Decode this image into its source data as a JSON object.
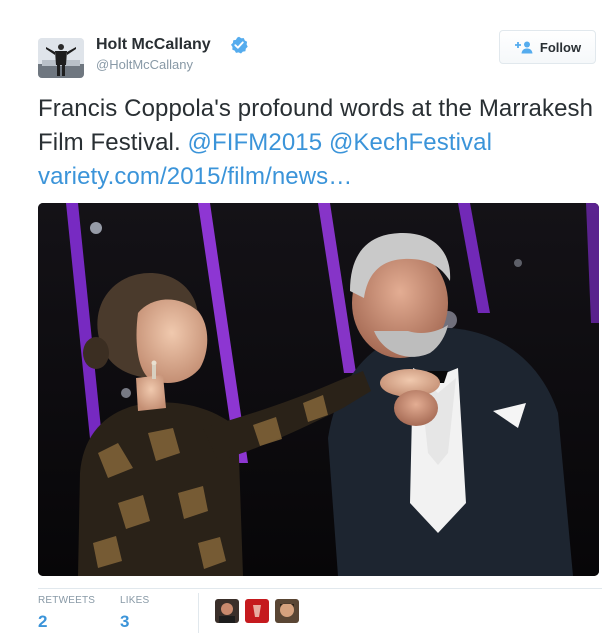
{
  "user": {
    "display_name": "Holt McCallany",
    "username": "@HoltMcCallany",
    "verified": true,
    "avatar_icon": "user-avatar"
  },
  "follow_button": {
    "label": "Follow",
    "icon": "add-user-icon"
  },
  "tweet": {
    "text_plain": "Francis Coppola's profound words at the Marrakesh Film Festival.",
    "mention_1": "@FIFM2015",
    "mention_2": "@KechFestival",
    "link": "variety.com/2015/film/news…",
    "link_color": "#3b94d9"
  },
  "stats": {
    "retweets_label": "RETWEETS",
    "retweets_value": "2",
    "likes_label": "LIKES",
    "likes_value": "3"
  },
  "likers": [
    "liker-avatar-1",
    "liker-avatar-2",
    "liker-avatar-3"
  ],
  "colors": {
    "accent": "#3b94d9",
    "muted": "#8899a6",
    "text": "#292f33",
    "verified": "#55acee"
  }
}
